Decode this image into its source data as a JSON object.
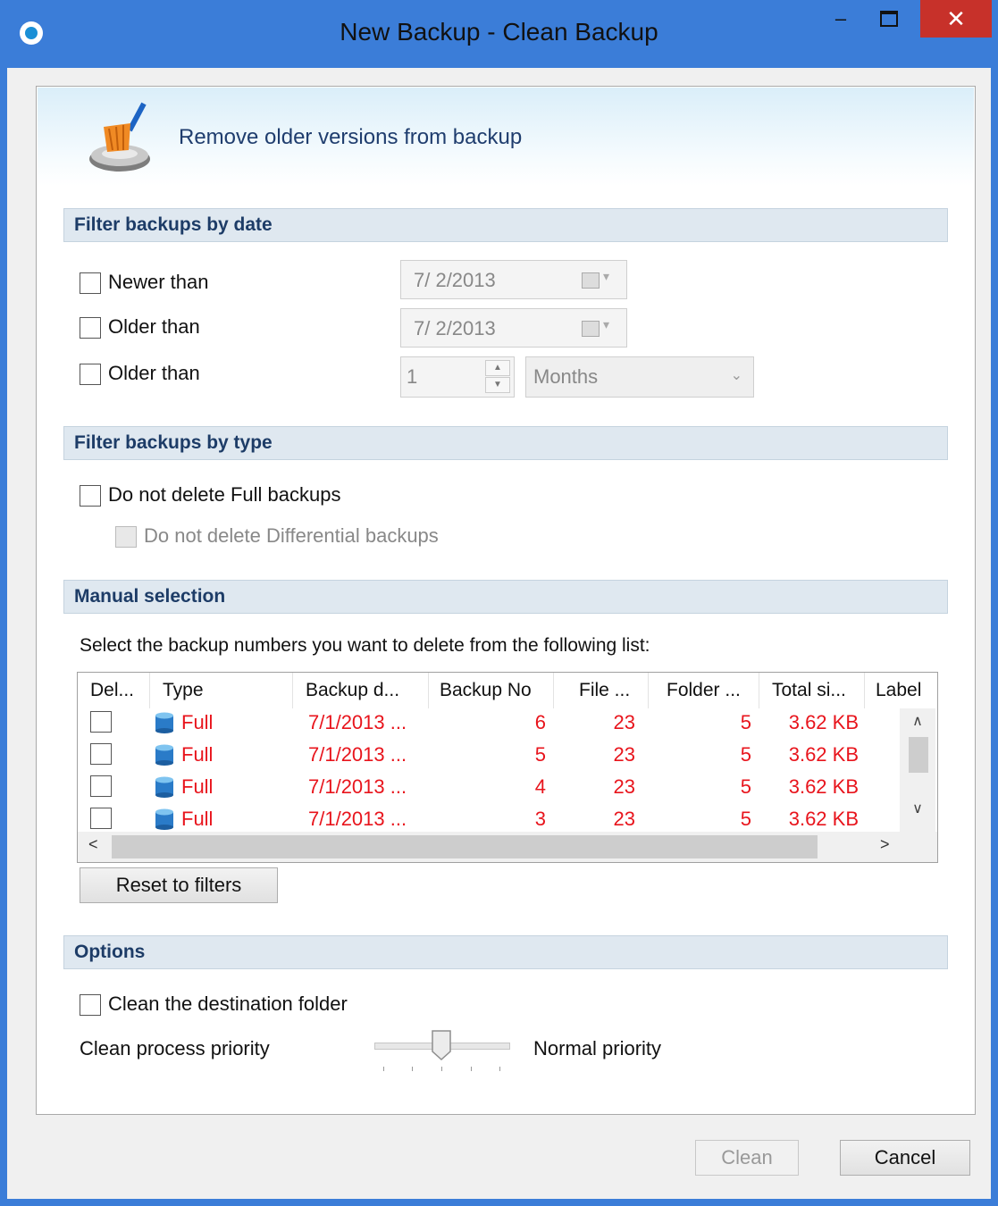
{
  "window": {
    "title": "New Backup - Clean Backup",
    "min_glyph": "–",
    "close_glyph": "✕"
  },
  "banner": {
    "text": "Remove older versions from backup",
    "icon": "broom-icon"
  },
  "filter_date": {
    "heading": "Filter backups by date",
    "newer_label": "Newer than",
    "newer_date": "7/  2/2013",
    "older_label": "Older than",
    "older_date": "7/  2/2013",
    "older2_label": "Older than",
    "older2_value": "1",
    "older2_unit": "Months"
  },
  "filter_type": {
    "heading": "Filter backups by type",
    "no_full_label": "Do not delete Full backups",
    "no_diff_label": "Do not delete Differential backups"
  },
  "manual": {
    "heading": "Manual selection",
    "instruction": "Select the backup numbers you want to delete from the following list:",
    "columns": [
      "Del...",
      "Type",
      "Backup d...",
      "Backup No",
      "File ...",
      "Folder ...",
      "Total si...",
      "Label"
    ],
    "rows": [
      {
        "type": "Full",
        "date": "7/1/2013 ...",
        "no": "6",
        "files": "23",
        "folders": "5",
        "size": "3.62 KB"
      },
      {
        "type": "Full",
        "date": "7/1/2013 ...",
        "no": "5",
        "files": "23",
        "folders": "5",
        "size": "3.62 KB"
      },
      {
        "type": "Full",
        "date": "7/1/2013 ...",
        "no": "4",
        "files": "23",
        "folders": "5",
        "size": "3.62 KB"
      },
      {
        "type": "Full",
        "date": "7/1/2013 ...",
        "no": "3",
        "files": "23",
        "folders": "5",
        "size": "3.62 KB"
      }
    ],
    "reset_label": "Reset to filters"
  },
  "options": {
    "heading": "Options",
    "clean_dest_label": "Clean the destination folder",
    "priority_label": "Clean process priority",
    "priority_value_label": "Normal priority",
    "priority_level": 0.5
  },
  "footer": {
    "clean_label": "Clean",
    "cancel_label": "Cancel"
  },
  "colors": {
    "accent": "#3b7dd8",
    "close": "#c7312a",
    "row_text": "#e8141c",
    "section_text": "#1d3c67"
  }
}
